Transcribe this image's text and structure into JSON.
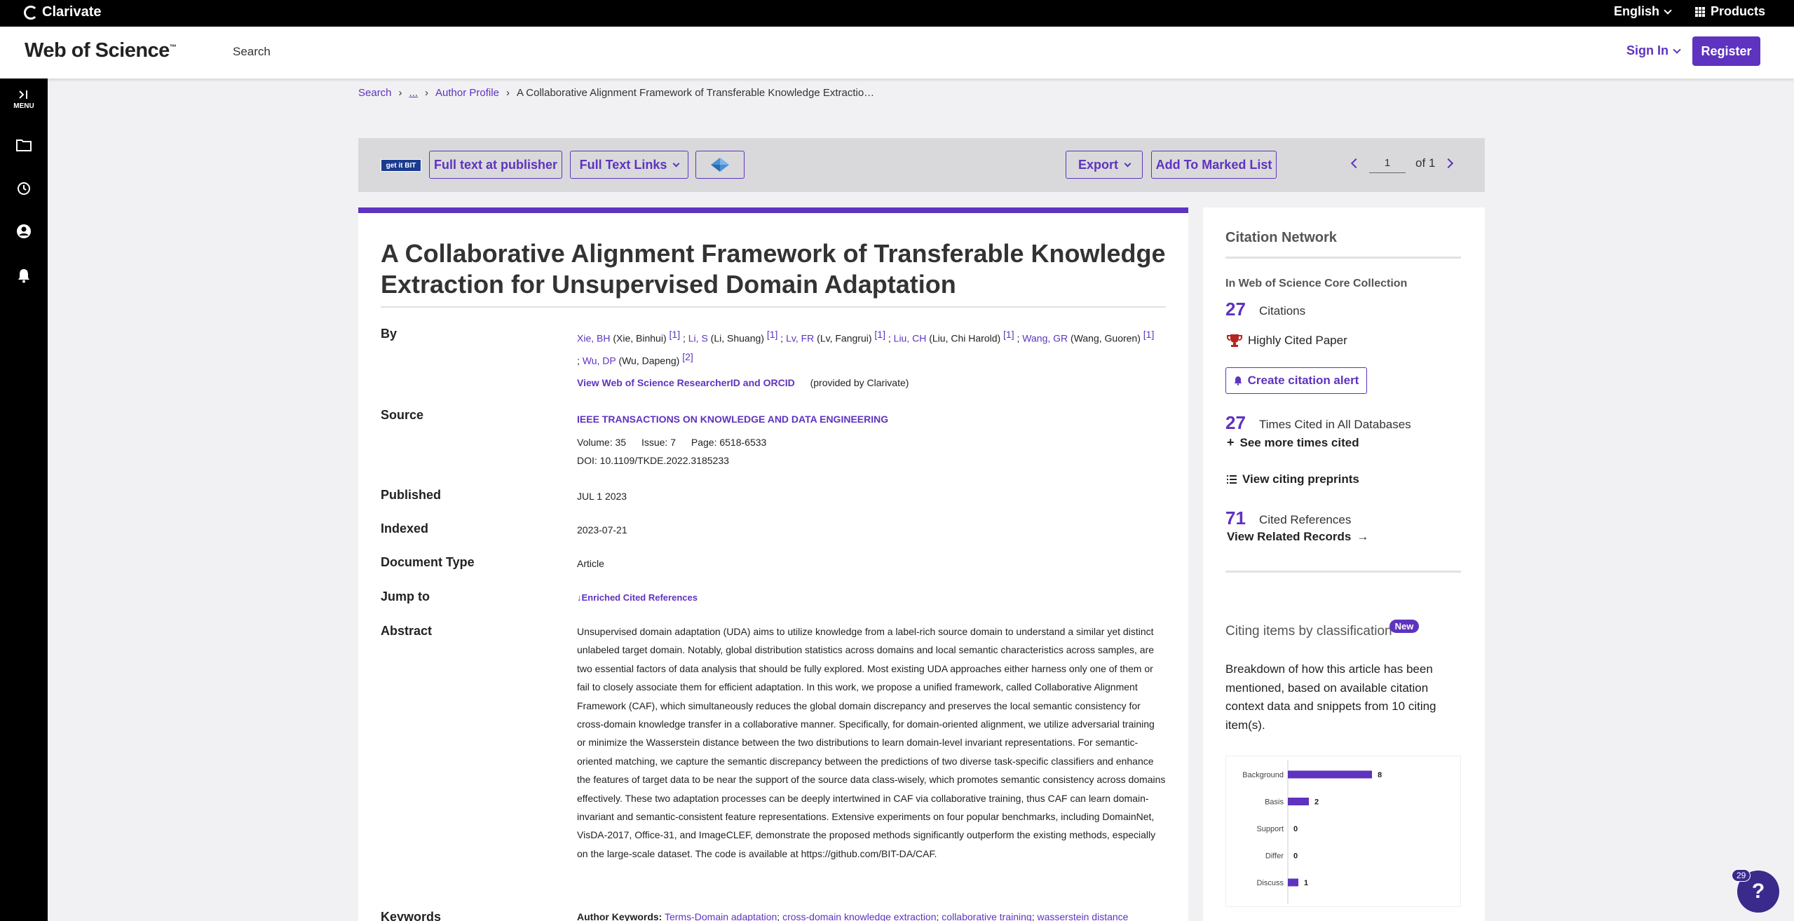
{
  "topbar": {
    "brand": "Clarivate",
    "language": "English",
    "products": "Products"
  },
  "header": {
    "logo": "Web of Science",
    "logo_tm": "™",
    "nav_search": "Search",
    "sign_in": "Sign In",
    "register": "Register"
  },
  "sidebar": {
    "menu_label": "MENU",
    "icons": [
      "expand-menu-icon",
      "folder-icon",
      "history-icon",
      "user-icon",
      "bell-icon"
    ]
  },
  "breadcrumb": {
    "search": "Search",
    "ellipsis": "...",
    "author_profile": "Author Profile",
    "current": "A Collaborative Alignment Framework of Transferable Knowledge Extractio…",
    "sep": "›"
  },
  "toolbar": {
    "getit": "get it BIT",
    "full_text_publisher": "Full text at publisher",
    "full_text_links": "Full Text Links",
    "export": "Export",
    "add_marked": "Add To Marked List",
    "page_value": "1",
    "page_of": "of",
    "page_total": "1"
  },
  "record": {
    "title": "A Collaborative Alignment Framework of Transferable Knowledge Extraction for Unsupervised Domain Adaptation",
    "labels": {
      "by": "By",
      "source": "Source",
      "published": "Published",
      "indexed": "Indexed",
      "doc_type": "Document Type",
      "jump_to": "Jump to",
      "abstract": "Abstract",
      "keywords": "Keywords"
    },
    "authors": [
      {
        "short": "Xie, BH",
        "full": "(Xie, Binhui)",
        "ref": "[1]"
      },
      {
        "short": "Li, S",
        "full": "(Li, Shuang)",
        "ref": "[1]"
      },
      {
        "short": "Lv, FR",
        "full": "(Lv, Fangrui)",
        "ref": "[1]"
      },
      {
        "short": "Liu, CH",
        "full": "(Liu, Chi Harold)",
        "ref": "[1]"
      },
      {
        "short": "Wang, GR",
        "full": "(Wang, Guoren)",
        "ref": "[1]"
      },
      {
        "short": "Wu, DP",
        "full": "(Wu, Dapeng)",
        "ref": "[2]"
      }
    ],
    "researcher_link": "View Web of Science ResearcherID and ORCID",
    "provided_by": "(provided by Clarivate)",
    "source_journal": "IEEE TRANSACTIONS ON KNOWLEDGE AND DATA ENGINEERING",
    "volume": "Volume: 35",
    "issue": "Issue: 7",
    "page": "Page: 6518-6533",
    "doi": "DOI: 10.1109/TKDE.2022.3185233",
    "published": "JUL 1 2023",
    "indexed": "2023-07-21",
    "doc_type": "Article",
    "jump_to": "Enriched Cited References",
    "abstract": "Unsupervised domain adaptation (UDA) aims to utilize knowledge from a label-rich source domain to understand a similar yet distinct unlabeled target domain. Notably, global distribution statistics across domains and local semantic characteristics across samples, are two essential factors of data analysis that should be fully explored. Most existing UDA approaches either harness only one of them or fail to closely associate them for efficient adaptation. In this work, we propose a unified framework, called Collaborative Alignment Framework (CAF), which simultaneously reduces the global domain discrepancy and preserves the local semantic consistency for cross-domain knowledge transfer in a collaborative manner. Specifically, for domain-oriented alignment, we utilize adversarial training or minimize the Wasserstein distance between the two distributions to learn domain-level invariant representations. For semantic-oriented matching, we capture the semantic discrepancy between the predictions of two diverse task-specific classifiers and enhance the features of target data to be near the support of the source data class-wisely, which promotes semantic consistency across domains effectively. These two adaptation processes can be deeply intertwined in CAF via collaborative training, thus CAF can learn domain-invariant and semantic-consistent feature representations. Extensive experiments on four popular benchmarks, including DomainNet, VisDA-2017, Office-31, and ImageCLEF, demonstrate the proposed methods significantly outperform the existing methods, especially on the large-scale dataset. The code is available at https://github.com/BIT-DA/CAF.",
    "author_keywords_label": "Author Keywords:",
    "keywords": [
      "Terms-Domain adaptation",
      "cross-domain knowledge extraction",
      "collaborative training",
      "wasserstein distance"
    ]
  },
  "citation_network": {
    "title": "Citation Network",
    "core_collection": "In Web of Science Core Collection",
    "citations_count": "27",
    "citations_label": "Citations",
    "highly_cited": "Highly Cited Paper",
    "create_alert": "Create citation alert",
    "times_cited_count": "27",
    "times_cited_label": "Times Cited in All Databases",
    "see_more": "See more times cited",
    "view_preprints": "View citing preprints",
    "cited_refs_count": "71",
    "cited_refs_label": "Cited References",
    "view_related": "View Related Records",
    "classification_title": "Citing items by classification",
    "new_badge": "New",
    "classification_desc": "Breakdown of how this article has been mentioned, based on available citation context data and snippets from 10 citing item(s)."
  },
  "chart_data": {
    "type": "bar",
    "orientation": "horizontal",
    "categories": [
      "Background",
      "Basis",
      "Support",
      "Differ",
      "Discuss"
    ],
    "values": [
      8,
      2,
      0,
      0,
      1
    ],
    "color": "#5e33bf"
  },
  "help": {
    "label": "?",
    "count": "29"
  }
}
